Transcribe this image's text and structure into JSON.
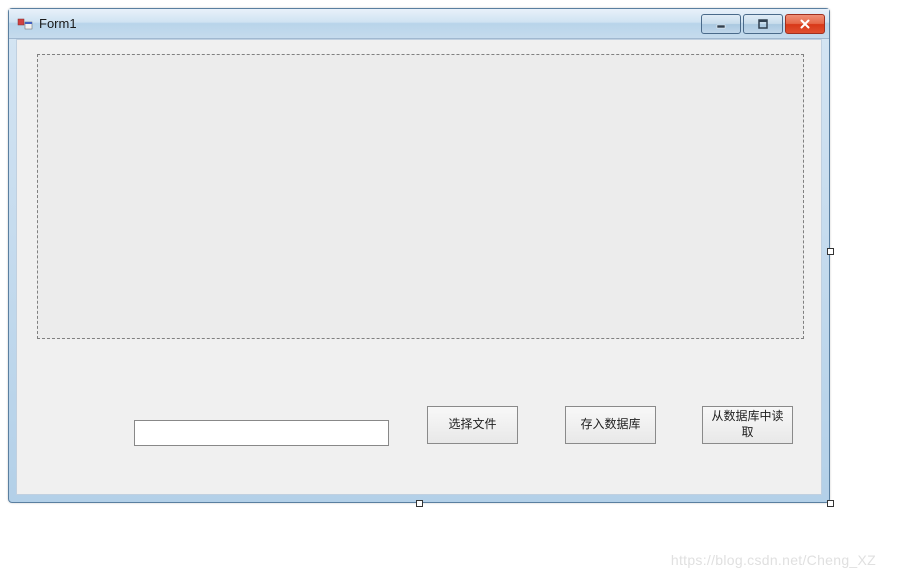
{
  "window": {
    "title": "Form1"
  },
  "controls": {
    "textbox_value": "",
    "button_select_file": "选择文件",
    "button_save_to_db": "存入数据库",
    "button_read_from_db": "从数据库中读取"
  },
  "watermark": "https://blog.csdn.net/Cheng_XZ"
}
